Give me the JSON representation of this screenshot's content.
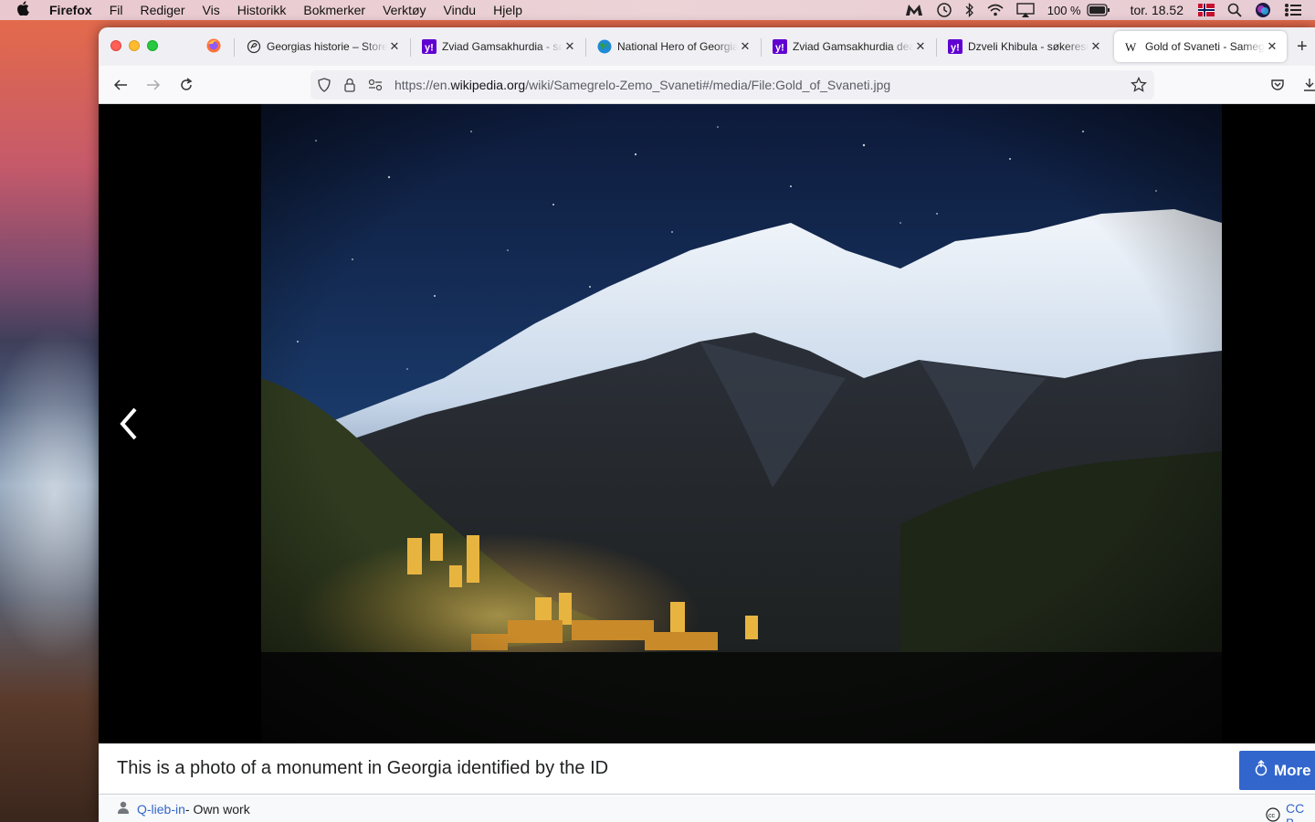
{
  "menubar": {
    "app_name": "Firefox",
    "items": [
      "Fil",
      "Rediger",
      "Vis",
      "Historikk",
      "Bokmerker",
      "Verktøy",
      "Vindu",
      "Hjelp"
    ],
    "battery_percent": "100 %",
    "clock": "tor. 18.52",
    "icons": [
      "apple-icon",
      "malwarebytes-icon",
      "time-machine-icon",
      "bluetooth-icon",
      "wifi-icon",
      "airplay-icon",
      "battery-icon",
      "norway-flag-icon",
      "spotlight-icon",
      "siri-icon",
      "control-center-icon"
    ]
  },
  "tabs": [
    {
      "label": "Georgias historie – Store norske leksikon",
      "icon": "snl-icon"
    },
    {
      "label": "Zviad Gamsakhurdia - søk",
      "icon": "yahoo-icon"
    },
    {
      "label": "National Hero of Georgia",
      "icon": "globe-icon"
    },
    {
      "label": "Zviad Gamsakhurdia death",
      "icon": "yahoo-icon"
    },
    {
      "label": "Dzveli Khibula - søkeresultat",
      "icon": "yahoo-icon"
    },
    {
      "label": "Gold of Svaneti - Samegrelo-Zemo Svaneti",
      "icon": "wikipedia-icon",
      "active": true
    }
  ],
  "url": {
    "scheme": "https://en.",
    "host": "wikipedia.org",
    "path": "/wiki/Samegrelo-Zemo_Svaneti#/media/File:Gold_of_Svaneti.jpg"
  },
  "media": {
    "caption": "This is a photo of a monument in Georgia identified by the ID",
    "more_button": "More",
    "author": "Q-lieb-in",
    "author_suffix": " - Own work",
    "license": "CC B"
  },
  "colors": {
    "link": "#3366cc",
    "more_button_bg": "#3366cc",
    "viewer_bg": "#000000"
  }
}
